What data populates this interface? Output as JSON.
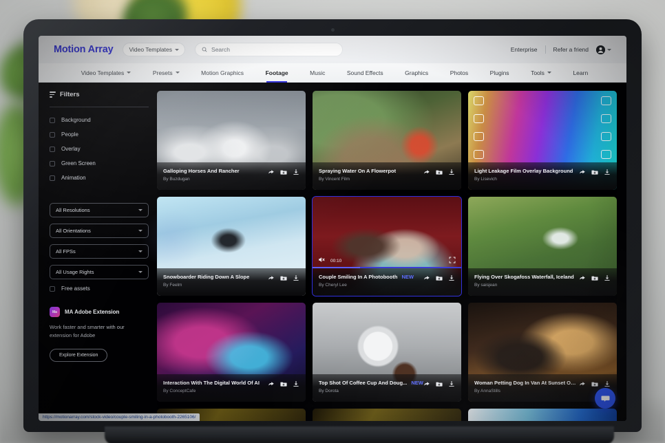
{
  "browser": {
    "status_url": "https://motionarray.com/stock-video/couple-smiling-in-a-photobooth-2265106/"
  },
  "header": {
    "brand": "Motion Array",
    "category_selector": "Video Templates",
    "search_placeholder": "Search",
    "enterprise_label": "Enterprise",
    "refer_label": "Refer a friend",
    "accent_color": "#2b2bd9"
  },
  "nav": {
    "items": [
      {
        "label": "Video Templates",
        "caret": true,
        "active": false
      },
      {
        "label": "Presets",
        "caret": true,
        "active": false
      },
      {
        "label": "Motion Graphics",
        "caret": false,
        "active": false
      },
      {
        "label": "Footage",
        "caret": false,
        "active": true
      },
      {
        "label": "Music",
        "caret": false,
        "active": false
      },
      {
        "label": "Sound Effects",
        "caret": false,
        "active": false
      },
      {
        "label": "Graphics",
        "caret": false,
        "active": false
      },
      {
        "label": "Photos",
        "caret": false,
        "active": false
      },
      {
        "label": "Plugins",
        "caret": false,
        "active": false
      },
      {
        "label": "Tools",
        "caret": true,
        "active": false
      },
      {
        "label": "Learn",
        "caret": false,
        "active": false
      }
    ]
  },
  "sidebar": {
    "title": "Filters",
    "checkboxes": [
      {
        "label": "Background",
        "checked": false
      },
      {
        "label": "People",
        "checked": false
      },
      {
        "label": "Overlay",
        "checked": false
      },
      {
        "label": "Green Screen",
        "checked": false
      },
      {
        "label": "Animation",
        "checked": false
      }
    ],
    "selects": [
      {
        "label": "All Resolutions"
      },
      {
        "label": "All Orientations"
      },
      {
        "label": "All FPSs"
      },
      {
        "label": "All Usage Rights"
      }
    ],
    "free_assets": {
      "label": "Free assets",
      "checked": false
    },
    "promo": {
      "badge": "Ma",
      "title": "MA Adobe Extension",
      "subtitle": "Work faster and smarter with our extension for Adobe",
      "button": "Explore Extension"
    }
  },
  "grid": {
    "cards": [
      {
        "title": "Galloping Horses And Rancher",
        "author": "By Buzdugan",
        "thumb": "t-horses",
        "badge": "",
        "active": false
      },
      {
        "title": "Spraying Water On A Flowerpot",
        "author": "By Vincent Film",
        "thumb": "t-flower",
        "badge": "",
        "active": false
      },
      {
        "title": "Light Leakage Film Overlay Background",
        "author": "By Lisevich",
        "thumb": "t-filmstrip",
        "badge": "",
        "active": false
      },
      {
        "title": "Snowboarder Riding Down A Slope",
        "author": "By Feelm",
        "thumb": "t-snow",
        "badge": "",
        "active": false
      },
      {
        "title": "Couple Smiling In A Photobooth",
        "author": "By Cheryl Lee",
        "thumb": "t-photobooth",
        "badge": "NEW",
        "active": true
      },
      {
        "title": "Flying Over Skogafoss Waterfall, Iceland",
        "author": "By saisjean",
        "thumb": "t-waterfall",
        "badge": "",
        "active": false
      },
      {
        "title": "Interaction With The Digital World Of AI",
        "author": "By ConceptCafe",
        "thumb": "t-ai",
        "badge": "",
        "active": false
      },
      {
        "title": "Top Shot Of Coffee Cup And Doug...",
        "author": "By Dorota",
        "thumb": "t-coffee",
        "badge": "NEW",
        "active": false
      },
      {
        "title": "Woman Petting Dog In Van At Sunset On ...",
        "author": "By AnnaStills",
        "thumb": "t-dog",
        "badge": "",
        "active": false
      }
    ],
    "partial_row": [
      {
        "thumb": "t-row4a"
      },
      {
        "thumb": "t-row4a"
      },
      {
        "thumb": "t-row4b"
      }
    ],
    "player": {
      "time": "00:10",
      "mute_icon": "volume-mute-icon",
      "fullscreen_icon": "fullscreen-icon",
      "progress_percent": 32
    },
    "card_actions": [
      "share-icon",
      "add-to-collection-icon",
      "download-icon"
    ]
  },
  "chat": {
    "icon": "chat-bubble-icon",
    "color": "#2a53f5"
  }
}
